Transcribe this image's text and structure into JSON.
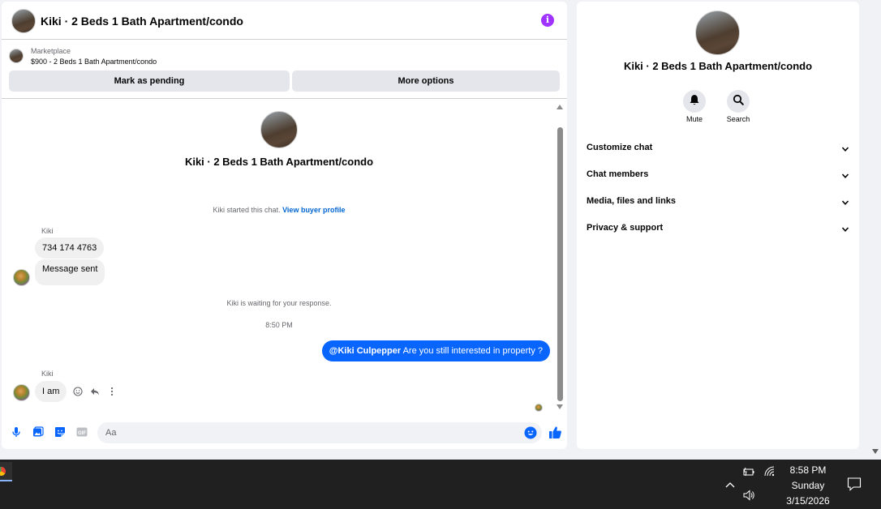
{
  "chat": {
    "title": "Kiki · 2 Beds 1 Bath Apartment/condo",
    "marketplace_label": "Marketplace",
    "listing": "$900 - 2 Beds 1 Bath Apartment/condo",
    "mark_pending": "Mark as pending",
    "more_options": "More options",
    "thread_title": "Kiki · 2 Beds 1 Bath Apartment/condo",
    "started_text": "Kiki started this chat.",
    "buyer_profile_link": "View buyer profile",
    "sender_1": "Kiki",
    "msg_1": "734 174 4763",
    "msg_2": "Message sent",
    "waiting_text": "Kiki is waiting for your response.",
    "timestamp": "8:50 PM",
    "out_mention": "@Kiki Culpepper",
    "out_text": "Are you still interested in property ?",
    "sender_2": "Kiki",
    "msg_3": "I am",
    "input_placeholder": "Aa"
  },
  "info": {
    "title": "Kiki · 2 Beds 1 Bath Apartment/condo",
    "mute_label": "Mute",
    "search_label": "Search",
    "sections": [
      "Customize chat",
      "Chat members",
      "Media, files and links",
      "Privacy & support"
    ]
  },
  "taskbar": {
    "time": "8:58 PM",
    "day": "Sunday",
    "date": "3/15/2026"
  },
  "colors": {
    "accent": "#0866ff",
    "info_icon": "#a033ff",
    "link": "#0064d1"
  },
  "icons": [
    "info-icon",
    "mic-icon",
    "photo-icon",
    "sticker-icon",
    "gif-icon",
    "emoji-icon",
    "like-icon",
    "bell-icon",
    "search-icon",
    "chevron-down-icon",
    "react-icon",
    "reply-icon",
    "more-icon",
    "battery-icon",
    "wifi-icon",
    "volume-icon",
    "notification-icon"
  ]
}
